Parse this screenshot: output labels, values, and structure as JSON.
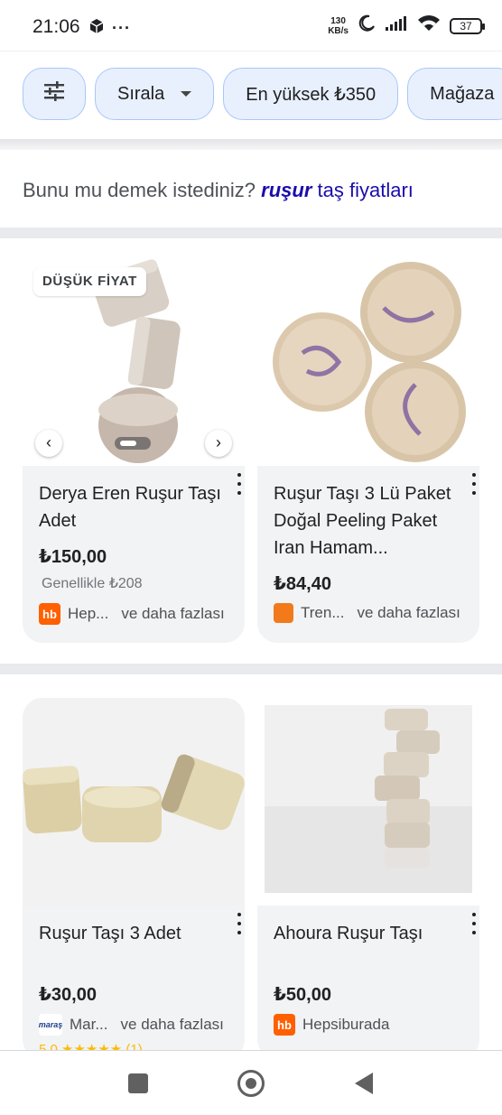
{
  "status_bar": {
    "time": "21:06",
    "more": "···",
    "speed_value": "130",
    "speed_unit": "KB/s",
    "battery": "37",
    "icons": [
      "box-icon",
      "moon-icon",
      "signal-icon",
      "wifi-icon",
      "battery-icon"
    ]
  },
  "filters": {
    "chips": [
      {
        "icon": "tune-icon"
      },
      {
        "label": "Sırala"
      },
      {
        "label": "En yüksek ₺350"
      },
      {
        "label": "Mağaza"
      }
    ]
  },
  "did_you_mean": {
    "prefix": "Bunu mu demek istediniz?",
    "suggestion_bold": "ruşur",
    "suggestion_rest": "taş fiyatları"
  },
  "products": [
    {
      "badge": "DÜŞÜK FİYAT",
      "title": "Derya Eren Ruşur Taşı Adet",
      "price": "₺150,00",
      "old_price": "Genellikle ₺208",
      "seller_logo": "hb",
      "seller_logo_color": "#ff6000",
      "seller": "Hep...",
      "more_sellers": "ve daha fazlası"
    },
    {
      "title": "Ruşur Taşı 3 Lü Paket Doğal Peeling Paket Iran Hamam...",
      "price": "₺84,40",
      "seller_logo": "trendyol",
      "seller_logo_color": "#f27a1a",
      "seller": "Tren...",
      "more_sellers": "ve daha fazlası"
    },
    {
      "title": "Ruşur Taşı 3 Adet",
      "price": "₺30,00",
      "seller_logo": "maraş",
      "seller_logo_color": "#1b3e8c",
      "seller": "Mar...",
      "more_sellers": "ve daha fazlası",
      "rating_text": "5,0 ★★★★★ (1)"
    },
    {
      "title": "Ahoura Ruşur Taşı",
      "price": "₺50,00",
      "seller_logo": "hb",
      "seller_logo_color": "#ff6000",
      "seller": "Hepsiburada"
    }
  ],
  "colors": {
    "chip_bg": "#e8f0fe",
    "chip_border": "#a8c7fa",
    "link": "#1a0dab",
    "card_bg": "#f1f3f4"
  }
}
